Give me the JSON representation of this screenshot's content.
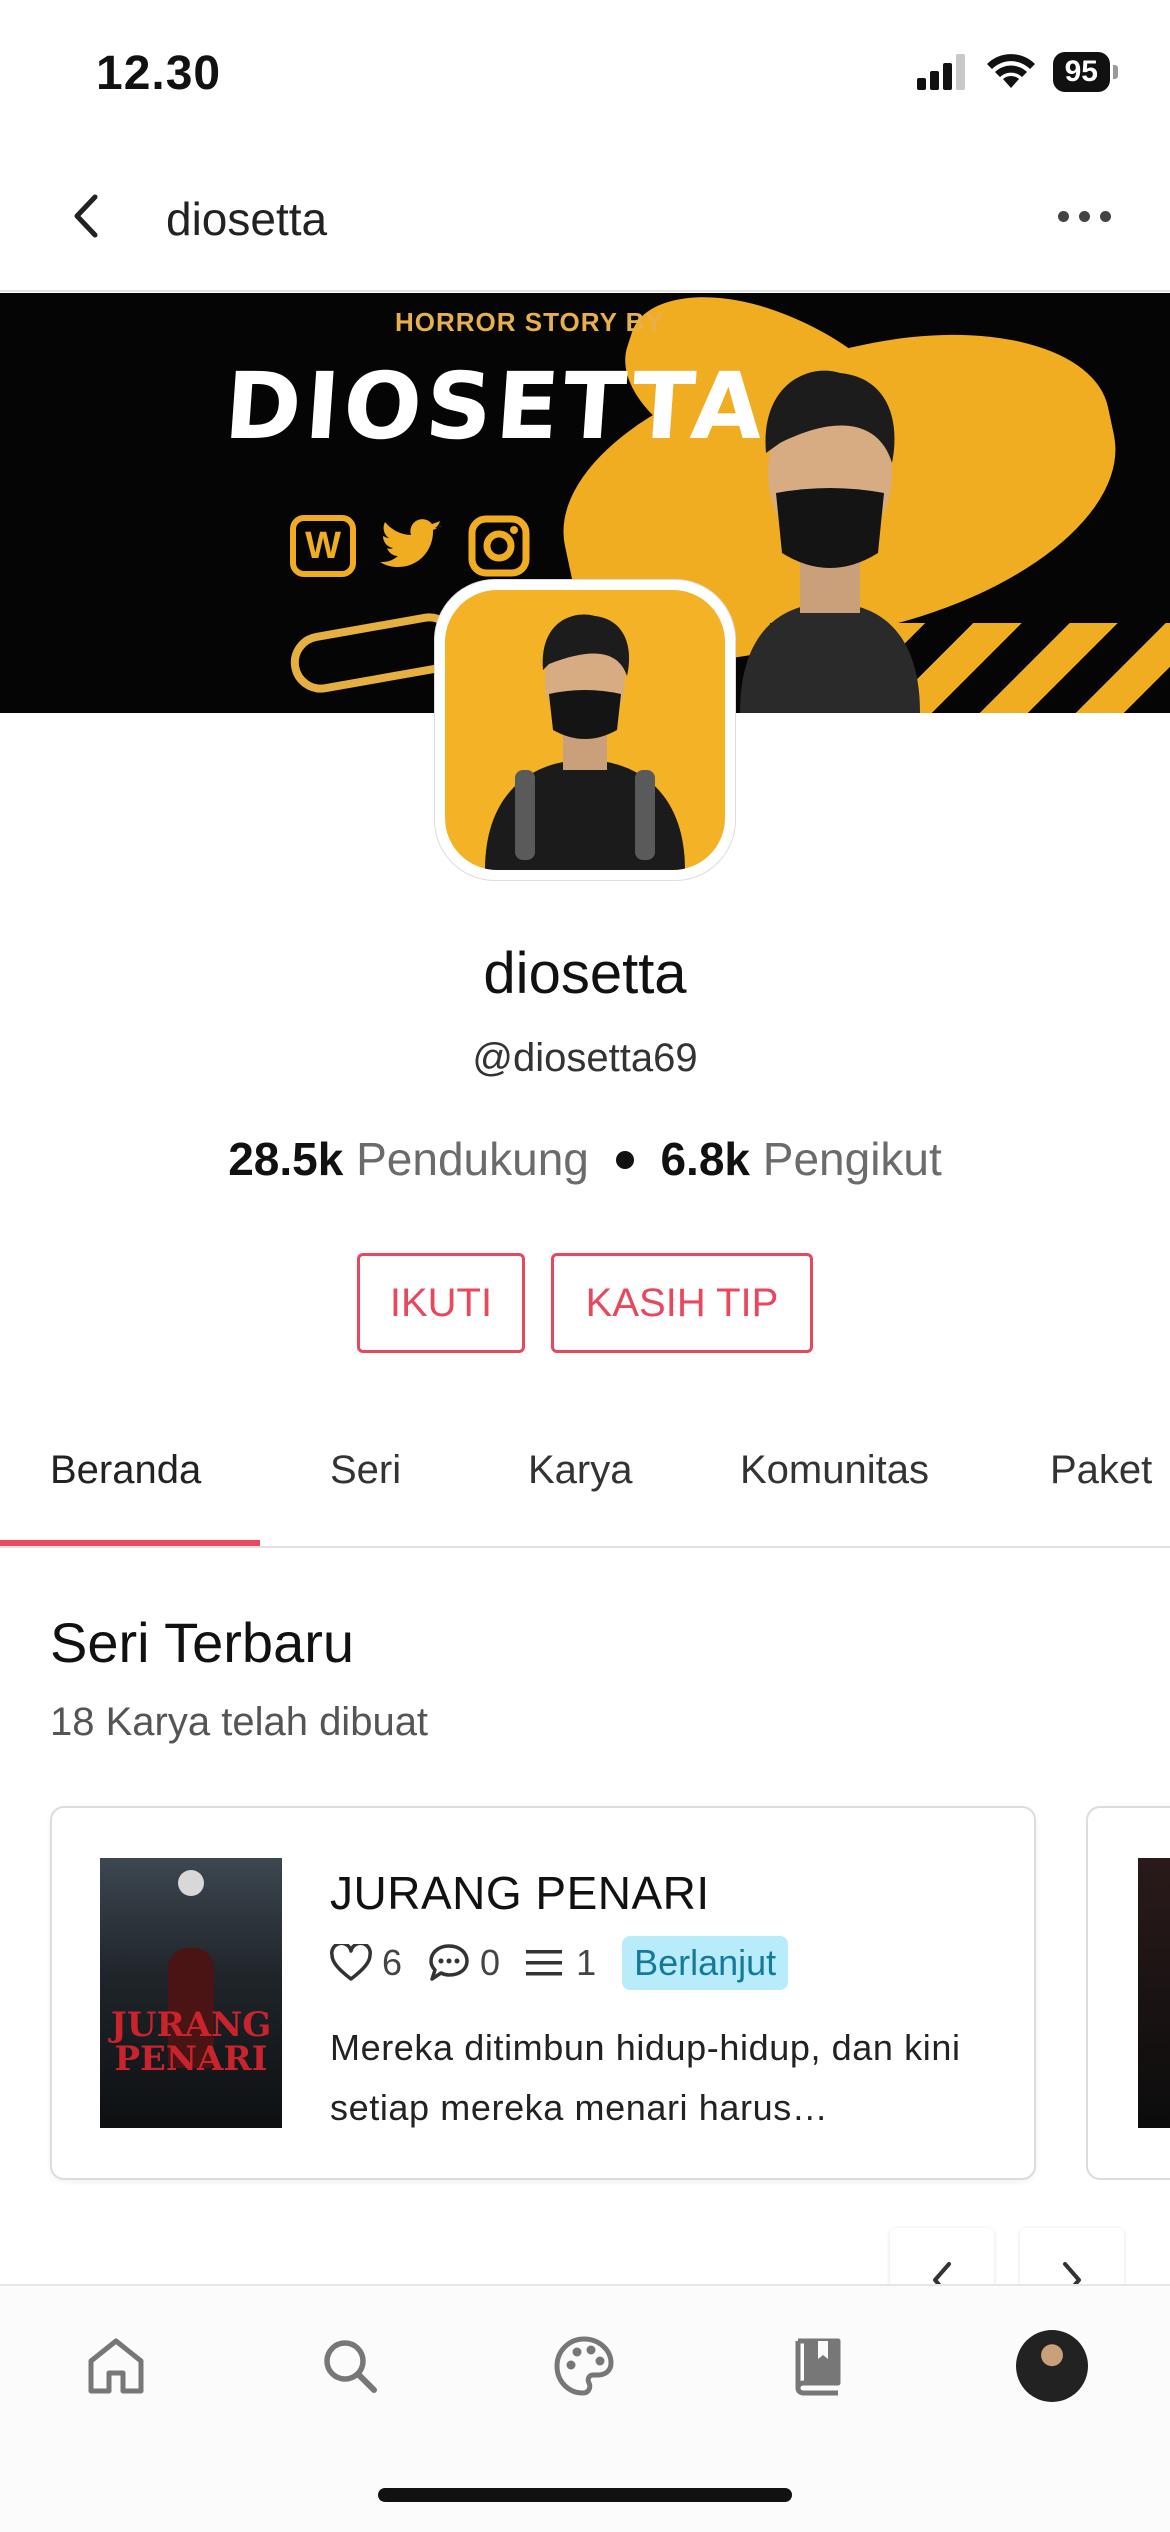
{
  "status_bar": {
    "time": "12.30",
    "battery": "95"
  },
  "nav": {
    "title": "diosetta"
  },
  "banner": {
    "tagline": "HORROR STORY BY",
    "logo_text": "DIOSETTA",
    "social_wattpad": "W"
  },
  "profile": {
    "name": "diosetta",
    "handle": "@diosetta69",
    "supporters_count": "28.5k",
    "supporters_label": "Pendukung",
    "followers_count": "6.8k",
    "followers_label": "Pengikut"
  },
  "actions": {
    "follow": "IKUTI",
    "tip": "KASIH TIP"
  },
  "tabs": [
    "Beranda",
    "Seri",
    "Karya",
    "Komunitas",
    "Paket"
  ],
  "section": {
    "title": "Seri Terbaru",
    "subtitle": "18 Karya telah dibuat"
  },
  "series_card": {
    "cover_title": "JURANG PENARI",
    "title": "JURANG PENARI",
    "likes": "6",
    "comments": "0",
    "chapters": "1",
    "status": "Berlanjut",
    "description": "Mereka ditimbun hidup-hidup, dan kini setiap mereka menari  harus…"
  },
  "colors": {
    "accent": "#e8475c",
    "badge_bg": "#b9ecfb",
    "banner_yellow": "#f0ad22"
  },
  "icons": {
    "back": "chevron-left-icon",
    "more": "ellipsis-icon",
    "like": "heart-icon",
    "comment": "comment-icon",
    "chapters": "list-icon",
    "tabbar": [
      "home-icon",
      "search-icon",
      "palette-icon",
      "book-icon",
      "avatar"
    ]
  }
}
